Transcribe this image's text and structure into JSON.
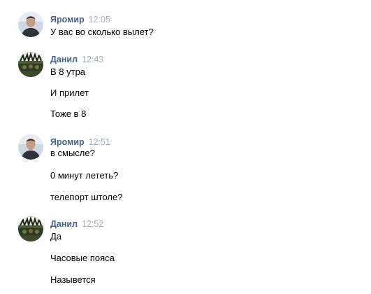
{
  "messages": [
    {
      "author": "Яромир",
      "time": "12:05",
      "avatar_icon": "user-photo-yaromir",
      "lines": [
        "У вас во сколько вылет?"
      ]
    },
    {
      "author": "Данил",
      "time": "12:43",
      "avatar_icon": "user-photo-danil",
      "lines": [
        "В 8 утра",
        "И прилет",
        "Тоже в 8"
      ]
    },
    {
      "author": "Яромир",
      "time": "12:51",
      "avatar_icon": "user-photo-yaromir",
      "lines": [
        "в смысле?",
        "0 минут лететь?",
        "телепорт штоле?"
      ]
    },
    {
      "author": "Данил",
      "time": "12:52",
      "avatar_icon": "user-photo-danil",
      "lines": [
        "Да",
        "Часовые пояса",
        "Назывется"
      ]
    }
  ],
  "colors": {
    "author": "#42648b",
    "time": "#a4aeb9",
    "text": "#000000",
    "background": "#ffffff"
  }
}
